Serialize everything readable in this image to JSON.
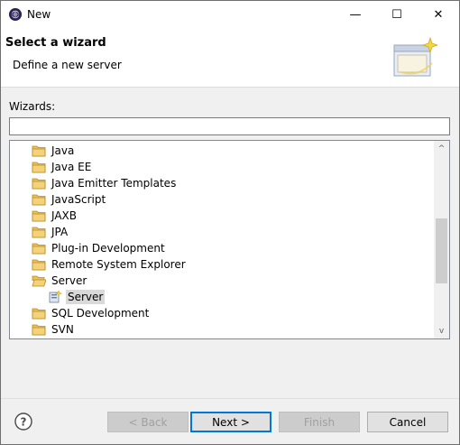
{
  "window": {
    "title": "New",
    "minimize_glyph": "—",
    "maximize_glyph": "☐",
    "close_glyph": "✕"
  },
  "banner": {
    "title": "Select a wizard",
    "description": "Define a new server"
  },
  "wizards": {
    "label": "Wizards:",
    "filter_value": "",
    "items": [
      {
        "label": "Java",
        "type": "folder",
        "selected": false
      },
      {
        "label": "Java EE",
        "type": "folder",
        "selected": false
      },
      {
        "label": "Java Emitter Templates",
        "type": "folder",
        "selected": false
      },
      {
        "label": "JavaScript",
        "type": "folder",
        "selected": false
      },
      {
        "label": "JAXB",
        "type": "folder",
        "selected": false
      },
      {
        "label": "JPA",
        "type": "folder",
        "selected": false
      },
      {
        "label": "Plug-in Development",
        "type": "folder",
        "selected": false
      },
      {
        "label": "Remote System Explorer",
        "type": "folder",
        "selected": false
      },
      {
        "label": "Server",
        "type": "folder-open",
        "selected": false
      },
      {
        "label": "Server",
        "type": "server-wizard",
        "selected": true
      },
      {
        "label": "SQL Development",
        "type": "folder",
        "selected": false
      },
      {
        "label": "SVN",
        "type": "folder",
        "selected": false
      }
    ]
  },
  "scrollbar": {
    "up_glyph": "^",
    "down_glyph": "v",
    "position_fraction": 0.45
  },
  "footer": {
    "back_label": "< Back",
    "next_label": "Next >",
    "finish_label": "Finish",
    "cancel_label": "Cancel"
  },
  "icons": {
    "app": "eclipse-icon",
    "help": "help-icon",
    "folder": "folder-icon",
    "server_wizard": "server-wizard-icon",
    "banner": "wizard-banner-icon"
  }
}
